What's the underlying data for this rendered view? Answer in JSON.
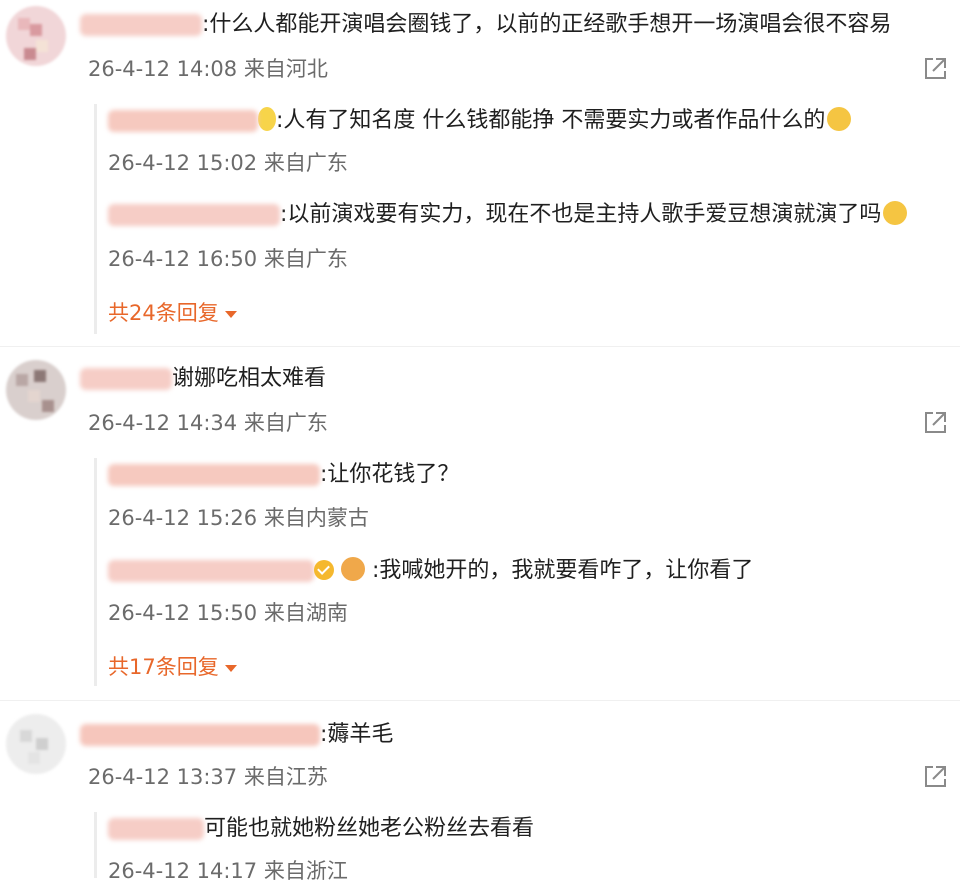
{
  "comments": [
    {
      "text": ":什么人都能开演唱会圈钱了，以前的正经歌手想开一场演唱会很不容易",
      "meta": "26-4-12 14:08 来自河北",
      "replies": [
        {
          "text": ":人有了知名度  什么钱都能挣  不需要实力或者作品什么的",
          "meta": "26-4-12 15:02 来自广东"
        },
        {
          "text": ":以前演戏要有实力，现在不也是主持人歌手爱豆想演就演了吗",
          "meta": "26-4-12 16:50 来自广东"
        }
      ],
      "more": "共24条回复"
    },
    {
      "text": "谢娜吃相太难看",
      "meta": "26-4-12 14:34 来自广东",
      "replies": [
        {
          "text": ":让你花钱了？",
          "meta": "26-4-12 15:26 来自内蒙古"
        },
        {
          "text": ":我喊她开的，我就要看咋了，让你看了",
          "meta": "26-4-12 15:50 来自湖南"
        }
      ],
      "more": "共17条回复"
    },
    {
      "text": ":薅羊毛",
      "meta": "26-4-12 13:37 来自江苏",
      "replies": [
        {
          "text": "可能也就她粉丝她老公粉丝去看看",
          "meta": "26-4-12 14:17 来自浙江"
        }
      ]
    }
  ],
  "icons": {
    "share": "share-icon",
    "expand": "caret-down-icon"
  },
  "colors": {
    "accent": "#e8672a",
    "meta": "#6b6b6b",
    "redaction": "#f6c9bf"
  }
}
